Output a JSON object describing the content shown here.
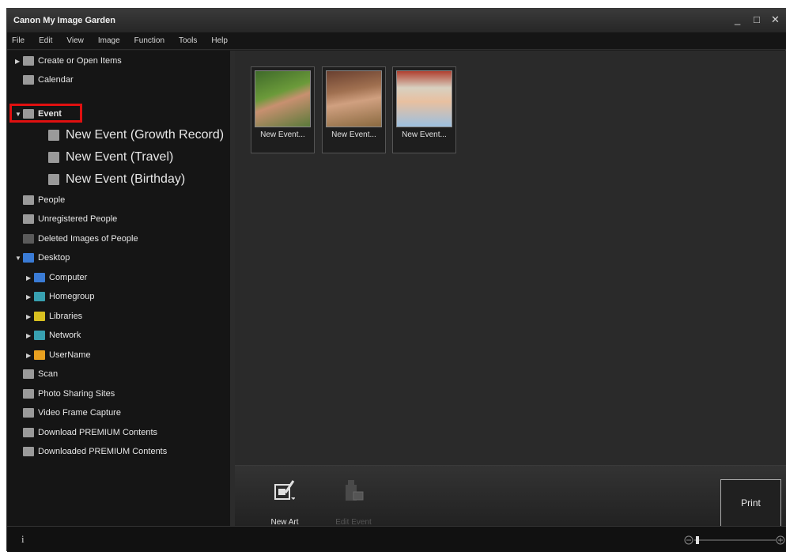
{
  "window": {
    "title": "Canon My Image Garden",
    "controls": {
      "minimize": "_",
      "maximize": "□",
      "close": "✕"
    }
  },
  "menu": [
    "File",
    "Edit",
    "View",
    "Image",
    "Function",
    "Tools",
    "Help"
  ],
  "sidebar": {
    "items": [
      {
        "label": "Create or Open Items",
        "arrow": "▶"
      },
      {
        "label": "Calendar"
      },
      {
        "label": "Event",
        "arrow": "▼"
      },
      {
        "label": "New Event (Growth Record)"
      },
      {
        "label": "New Event (Travel)"
      },
      {
        "label": "New Event (Birthday)"
      },
      {
        "label": "People"
      },
      {
        "label": "Unregistered People"
      },
      {
        "label": "Deleted Images of People"
      },
      {
        "label": "Desktop",
        "arrow": "▼"
      },
      {
        "label": "Computer",
        "arrow": "▶"
      },
      {
        "label": "Homegroup",
        "arrow": "▶"
      },
      {
        "label": "Libraries",
        "arrow": "▶"
      },
      {
        "label": "Network",
        "arrow": "▶"
      },
      {
        "label": "UserName",
        "arrow": "▶"
      },
      {
        "label": "Scan"
      },
      {
        "label": "Photo Sharing Sites"
      },
      {
        "label": "Video Frame Capture"
      },
      {
        "label": "Download PREMIUM Contents"
      },
      {
        "label": "Downloaded PREMIUM Contents"
      }
    ]
  },
  "thumbnails": [
    {
      "label": "New Event..."
    },
    {
      "label": "New Event..."
    },
    {
      "label": "New Event..."
    }
  ],
  "toolbar": {
    "new_art_label": "New Art",
    "edit_event_label": "Edit Event",
    "print_label": "Print"
  },
  "statusbar": {
    "info_glyph": "i"
  },
  "colors": {
    "highlight": "#e01010",
    "background": "#1c1c1c",
    "content": "#2a2a2a"
  }
}
